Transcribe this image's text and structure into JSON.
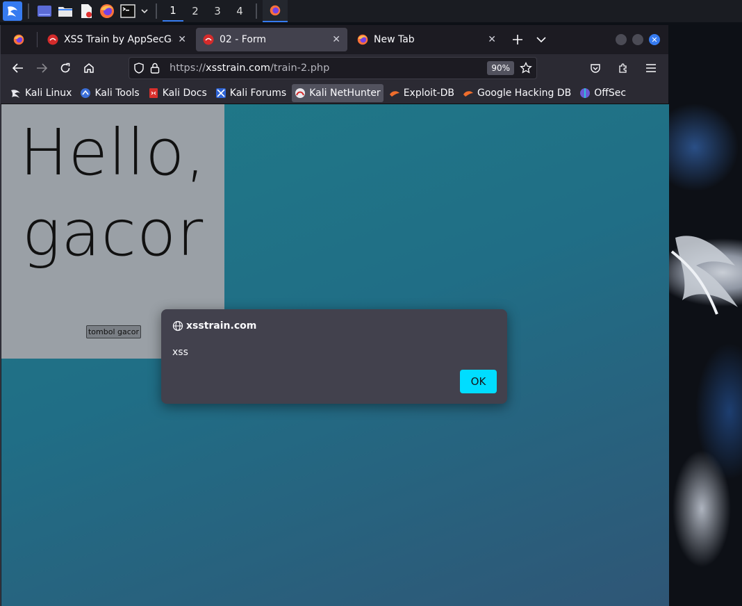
{
  "taskbar": {
    "workspaces": [
      "1",
      "2",
      "3",
      "4"
    ],
    "active_workspace": "1"
  },
  "browser": {
    "tabs": [
      {
        "title": "",
        "icon": "firefox-icon",
        "pinned": true
      },
      {
        "title": "XSS Train by AppSecGam",
        "icon": "appsec-icon",
        "active": false
      },
      {
        "title": "02 - Form",
        "icon": "appsec-icon",
        "active": true
      },
      {
        "title": "New Tab",
        "icon": "firefox-icon",
        "active": false
      }
    ],
    "url": {
      "scheme": "https://",
      "host": "xsstrain.com",
      "path": "/train-2.php"
    },
    "zoom": "90%",
    "bookmarks": [
      {
        "label": "Kali Linux",
        "icon": "kali-dragon-icon"
      },
      {
        "label": "Kali Tools",
        "icon": "kali-tools-icon"
      },
      {
        "label": "Kali Docs",
        "icon": "kali-docs-icon"
      },
      {
        "label": "Kali Forums",
        "icon": "kali-forums-icon"
      },
      {
        "label": "Kali NetHunter",
        "icon": "nethunter-icon"
      },
      {
        "label": "Exploit-DB",
        "icon": "exploit-db-icon"
      },
      {
        "label": "Google Hacking DB",
        "icon": "ghdb-icon"
      },
      {
        "label": "OffSec",
        "icon": "offsec-icon"
      }
    ]
  },
  "page": {
    "greeting_line1": "Hello,",
    "greeting_line2": "gacor",
    "button_label": "tombol gacor"
  },
  "alert": {
    "origin": "xsstrain.com",
    "message": "xss",
    "ok_label": "OK"
  },
  "colors": {
    "accent": "#367bf0",
    "ok_button": "#00ddff",
    "page_bg": "#1f7a88",
    "panel_gray": "#9aa0a6"
  }
}
